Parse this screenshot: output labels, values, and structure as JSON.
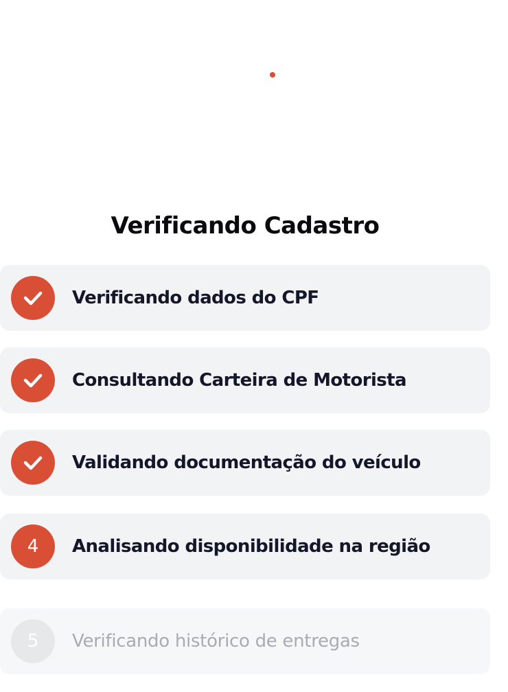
{
  "colors": {
    "accent": "#d94f36",
    "card_bg": "#f2f3f5",
    "text_dark": "#14162a",
    "text_muted": "#a8abb2"
  },
  "title": "Verificando Cadastro",
  "steps": [
    {
      "number": "1",
      "label": "Verificando dados do CPF",
      "status": "done",
      "icon": "check-icon"
    },
    {
      "number": "2",
      "label": "Consultando Carteira de Motorista",
      "status": "done",
      "icon": "check-icon"
    },
    {
      "number": "3",
      "label": "Validando documentação do veículo",
      "status": "done",
      "icon": "check-icon"
    },
    {
      "number": "4",
      "label": "Analisando disponibilidade na região",
      "status": "active"
    },
    {
      "number": "5",
      "label": "Verificando histórico de entregas",
      "status": "pending"
    }
  ]
}
